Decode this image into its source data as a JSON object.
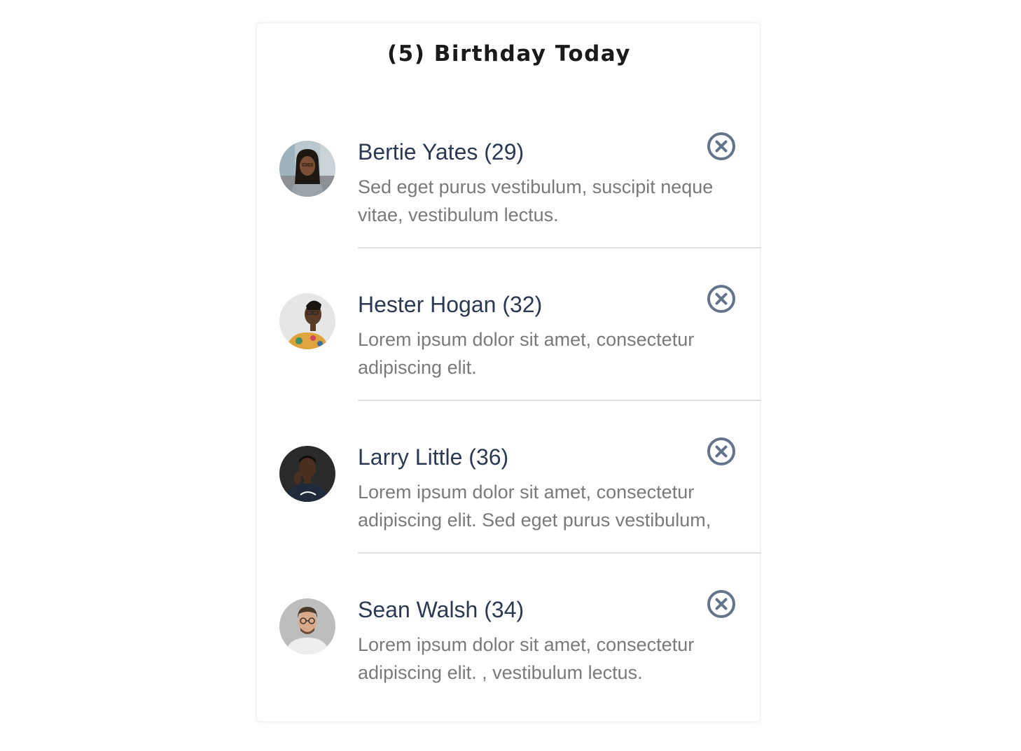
{
  "header": {
    "title": "(5) Birthday Today"
  },
  "colors": {
    "name_text": "#2b3a52",
    "description_text": "#7a7a7a",
    "close_icon": "#64748b",
    "divider": "#e0e0e0"
  },
  "birthdays": [
    {
      "name": "Bertie Yates (29)",
      "description": "Sed eget purus vestibulum, suscipit neque vitae, vestibulum lectus.",
      "avatar_icon": "avatar-photo",
      "close_icon": "close-circle-icon"
    },
    {
      "name": "Hester Hogan (32)",
      "description": "Lorem ipsum dolor sit amet, consectetur adipiscing elit.",
      "avatar_icon": "avatar-photo",
      "close_icon": "close-circle-icon"
    },
    {
      "name": "Larry Little (36)",
      "description": "Lorem ipsum dolor sit amet, consectetur adipiscing elit. Sed eget purus vestibulum,",
      "avatar_icon": "avatar-photo",
      "close_icon": "close-circle-icon"
    },
    {
      "name": "Sean Walsh (34)",
      "description": "Lorem ipsum dolor sit amet, consectetur adipiscing elit. , vestibulum lectus.",
      "avatar_icon": "avatar-photo",
      "close_icon": "close-circle-icon"
    }
  ]
}
